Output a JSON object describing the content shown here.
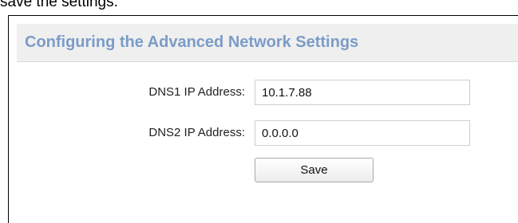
{
  "document": {
    "partial_line": "save the settings."
  },
  "panel": {
    "title": "Configuring the Advanced Network Settings"
  },
  "form": {
    "dns1": {
      "label": "DNS1 IP Address:",
      "value": "10.1.7.88"
    },
    "dns2": {
      "label": "DNS2 IP Address:",
      "value": "0.0.0.0"
    },
    "save_label": "Save"
  },
  "colors": {
    "title": "#7b9cc7",
    "header_background": "#efefef"
  }
}
